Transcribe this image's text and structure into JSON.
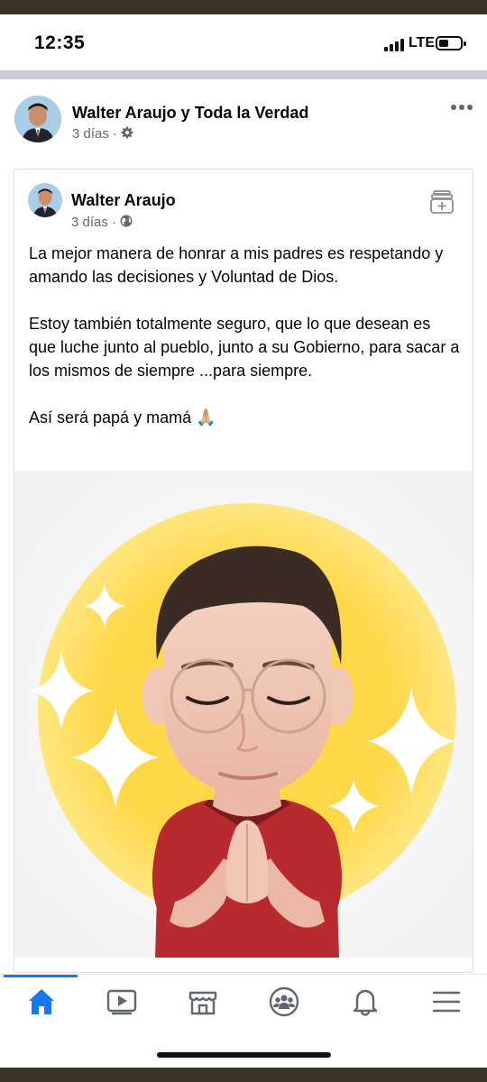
{
  "status_bar": {
    "time": "12:35",
    "network": "LTE",
    "icons": [
      "signal-bars-icon",
      "battery-icon"
    ]
  },
  "post": {
    "page_name": "Walter Araujo y Toda la Verdad",
    "time": "3 días",
    "separator": "·",
    "audience_icon": "gear-icon",
    "more_icon": "more-dots-icon"
  },
  "shared": {
    "author": "Walter Araujo",
    "time": "3 días",
    "separator": "·",
    "audience_icon": "globe-icon",
    "save_icon": "save-archive-icon",
    "paragraphs": [
      "La mejor manera de honrar a mis padres es respetando y amando las decisiones y Voluntad de Dios.",
      "Estoy también totalmente seguro, que lo que desean es que luche junto al pueblo, junto a su Gobierno, para sacar a los mismos de siempre ...para siempre.",
      "Así será papá y mamá 🙏🏼"
    ],
    "image": "praying-avatar-illustration"
  },
  "bottom_nav": {
    "items": [
      "home-icon",
      "video-icon",
      "marketplace-icon",
      "groups-icon",
      "notifications-icon",
      "menu-icon"
    ],
    "active": "home-icon"
  },
  "colors": {
    "accent": "#1877f2",
    "meta_text": "#65676b",
    "frame": "#3b3424",
    "divider": "#c9ccd1"
  }
}
